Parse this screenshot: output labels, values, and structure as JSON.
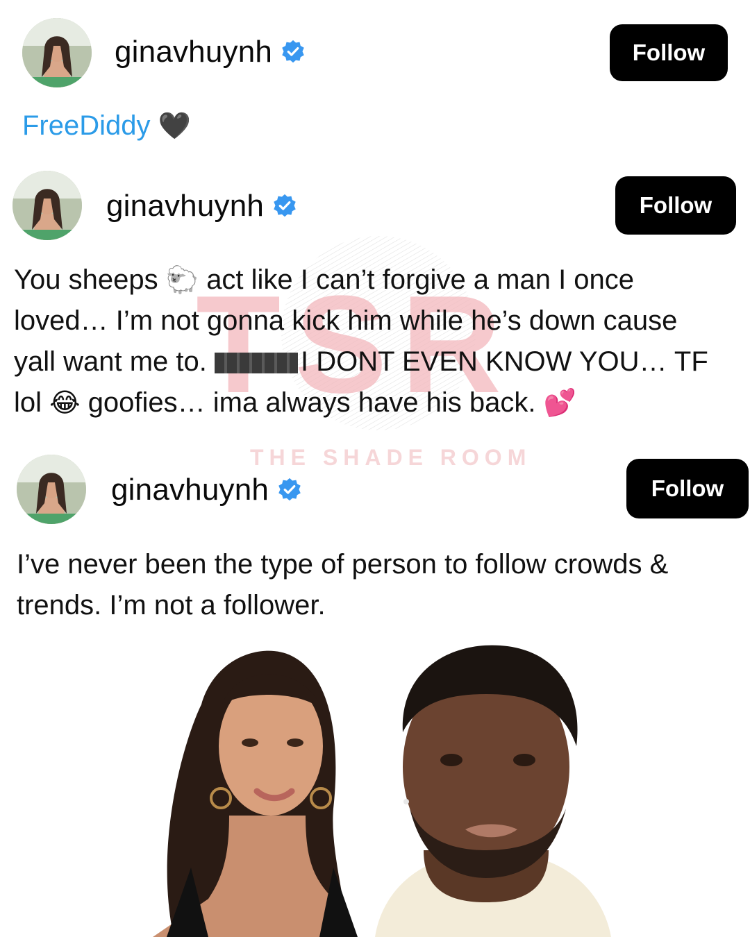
{
  "posts": [
    {
      "username": "ginavhuynh",
      "follow_label": "Follow",
      "caption_hashtag": "FreeDiddy",
      "caption_emoji": "🖤"
    },
    {
      "username": "ginavhuynh",
      "follow_label": "Follow",
      "lines": [
        {
          "before": "You sheeps",
          "emoji": "🐑",
          "after": "act like I can’t forgive a man I once"
        },
        {
          "text": "loved… I’m not gonna kick him while he’s down cause"
        },
        {
          "before": "yall want me to.",
          "after": "I DONT EVEN KNOW YOU… TF"
        },
        {
          "before": "lol",
          "emoji": "😂",
          "after": "goofies… ima always have his back.",
          "emoji2": "💕"
        }
      ]
    },
    {
      "username": "ginavhuynh",
      "follow_label": "Follow",
      "lines": [
        {
          "text": "I’ve never been the type of person to follow crowds &"
        },
        {
          "text": "trends. I’m not a follower."
        }
      ]
    }
  ],
  "watermark": {
    "logo": "TSR",
    "text": "THE SHADE ROOM"
  },
  "colors": {
    "verified": "#3897f0",
    "hashtag": "#2b9be8",
    "button": "#000000",
    "watermark": "#f3b8bd"
  },
  "icons": {
    "verified": "verified-badge-icon"
  }
}
